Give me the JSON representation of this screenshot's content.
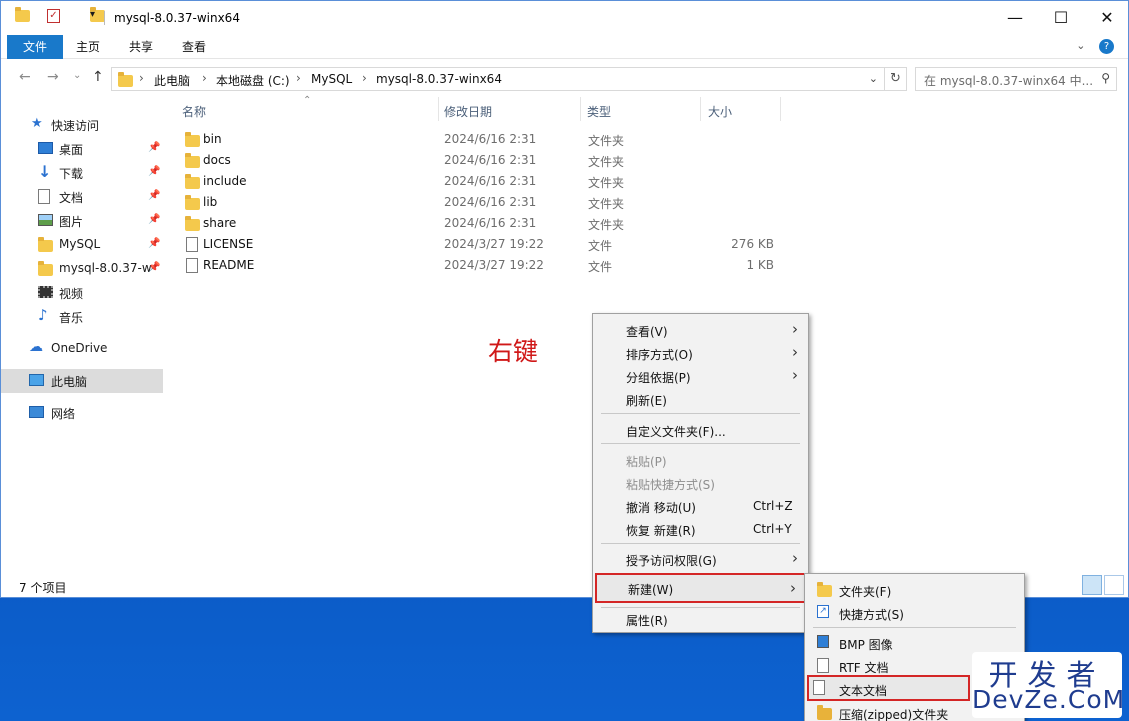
{
  "window": {
    "title": "mysql-8.0.37-winx64",
    "minimize": "—",
    "maximize": "☐",
    "close": "✕"
  },
  "ribbon": {
    "tabs": [
      "文件",
      "主页",
      "共享",
      "查看"
    ],
    "expand": "⌄"
  },
  "address": {
    "crumbs": [
      "此电脑",
      "本地磁盘 (C:)",
      "MySQL",
      "mysql-8.0.37-winx64"
    ],
    "search_placeholder": "在 mysql-8.0.37-winx64 中..."
  },
  "sidebar": {
    "items": [
      {
        "label": "快速访问",
        "icon": "star-icon"
      },
      {
        "label": "桌面",
        "icon": "desktop-icon",
        "pinned": true
      },
      {
        "label": "下载",
        "icon": "download-icon",
        "pinned": true
      },
      {
        "label": "文档",
        "icon": "document-icon",
        "pinned": true
      },
      {
        "label": "图片",
        "icon": "picture-icon",
        "pinned": true
      },
      {
        "label": "MySQL",
        "icon": "folder-icon",
        "pinned": true
      },
      {
        "label": "mysql-8.0.37-w",
        "icon": "folder-icon",
        "pinned": true
      },
      {
        "label": "视频",
        "icon": "video-icon"
      },
      {
        "label": "音乐",
        "icon": "music-icon"
      },
      {
        "label": "OneDrive",
        "icon": "cloud-icon"
      },
      {
        "label": "此电脑",
        "icon": "computer-icon",
        "selected": true
      },
      {
        "label": "网络",
        "icon": "network-icon"
      }
    ]
  },
  "columns": {
    "name": "名称",
    "date": "修改日期",
    "type": "类型",
    "size": "大小"
  },
  "files": [
    {
      "name": "bin",
      "date": "2024/6/16 2:31",
      "type": "文件夹",
      "size": "",
      "kind": "folder"
    },
    {
      "name": "docs",
      "date": "2024/6/16 2:31",
      "type": "文件夹",
      "size": "",
      "kind": "folder"
    },
    {
      "name": "include",
      "date": "2024/6/16 2:31",
      "type": "文件夹",
      "size": "",
      "kind": "folder"
    },
    {
      "name": "lib",
      "date": "2024/6/16 2:31",
      "type": "文件夹",
      "size": "",
      "kind": "folder"
    },
    {
      "name": "share",
      "date": "2024/6/16 2:31",
      "type": "文件夹",
      "size": "",
      "kind": "folder"
    },
    {
      "name": "LICENSE",
      "date": "2024/3/27 19:22",
      "type": "文件",
      "size": "276 KB",
      "kind": "file"
    },
    {
      "name": "README",
      "date": "2024/3/27 19:22",
      "type": "文件",
      "size": "1 KB",
      "kind": "file"
    }
  ],
  "annotation": "右键",
  "status": "7 个项目",
  "context_menu": {
    "items": [
      {
        "label": "查看(V)",
        "submenu": true
      },
      {
        "label": "排序方式(O)",
        "submenu": true
      },
      {
        "label": "分组依据(P)",
        "submenu": true
      },
      {
        "label": "刷新(E)"
      },
      {
        "label": "自定义文件夹(F)..."
      },
      {
        "label": "粘贴(P)",
        "disabled": true
      },
      {
        "label": "粘贴快捷方式(S)",
        "disabled": true
      },
      {
        "label": "撤消 移动(U)",
        "shortcut": "Ctrl+Z"
      },
      {
        "label": "恢复 新建(R)",
        "shortcut": "Ctrl+Y"
      },
      {
        "label": "授予访问权限(G)",
        "submenu": true
      },
      {
        "label": "新建(W)",
        "submenu": true,
        "highlighted": true
      },
      {
        "label": "属性(R)"
      }
    ]
  },
  "new_submenu": {
    "items": [
      {
        "label": "文件夹(F)",
        "icon": "folder-icon"
      },
      {
        "label": "快捷方式(S)",
        "icon": "shortcut-icon"
      },
      {
        "label": "BMP 图像",
        "icon": "bmp-icon"
      },
      {
        "label": "RTF 文档",
        "icon": "rtf-icon"
      },
      {
        "label": "文本文档",
        "icon": "text-document-icon",
        "highlighted": true
      },
      {
        "label": "压缩(zipped)文件夹",
        "icon": "zip-folder-icon"
      }
    ]
  },
  "watermark": {
    "line1": "开发者",
    "line2": "DevZe.CoM"
  }
}
